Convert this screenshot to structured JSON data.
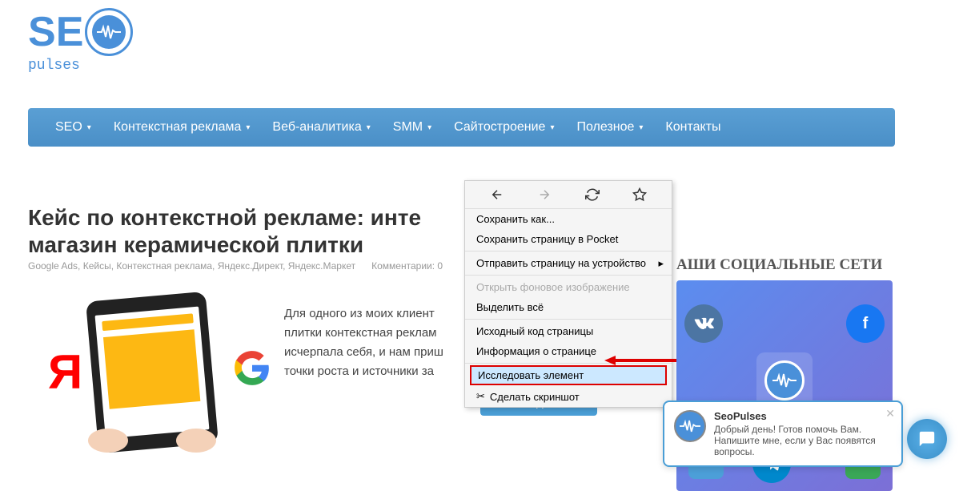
{
  "logo": {
    "brand": "SEO",
    "sub": "pulses"
  },
  "nav": [
    {
      "label": "SEO",
      "dropdown": true
    },
    {
      "label": "Контекстная реклама",
      "dropdown": true
    },
    {
      "label": "Веб-аналитика",
      "dropdown": true
    },
    {
      "label": "SMM",
      "dropdown": true
    },
    {
      "label": "Сайтостроение",
      "dropdown": true
    },
    {
      "label": "Полезное",
      "dropdown": true
    },
    {
      "label": "Контакты",
      "dropdown": false
    }
  ],
  "article": {
    "title": "Кейс по контекстной рекламе: интернет-магазин керамической плитки",
    "title_visible_part1": "Кейс по контекстной рекламе: инте",
    "title_visible_part2": "магазин керамической плитки",
    "categories": "Google Ads, Кейсы, Контекстная реклама, Яндекс.Директ, Яндекс.Маркет",
    "comments_label": "Комментарии: 0",
    "body": "Для одного из моих клиент плитки контекстная реклам исчерпала себя, и нам приш точки роста и источники за",
    "read_more": "Читать далее"
  },
  "sidebar": {
    "title": "АШИ СОЦИАЛЬНЫЕ СЕТИ"
  },
  "context_menu": {
    "items": [
      {
        "label": "Сохранить как...",
        "type": "item"
      },
      {
        "label": "Сохранить страницу в Pocket",
        "type": "item"
      },
      {
        "type": "divider"
      },
      {
        "label": "Отправить страницу на устройство",
        "type": "submenu"
      },
      {
        "type": "divider"
      },
      {
        "label": "Открыть фоновое изображение",
        "type": "disabled"
      },
      {
        "label": "Выделить всё",
        "type": "item"
      },
      {
        "type": "divider"
      },
      {
        "label": "Исходный код страницы",
        "type": "item"
      },
      {
        "label": "Информация о странице",
        "type": "item"
      },
      {
        "type": "divider"
      },
      {
        "label": "Исследовать элемент",
        "type": "highlighted"
      },
      {
        "label": "Сделать скриншот",
        "type": "last"
      }
    ]
  },
  "chat": {
    "title": "SeoPulses",
    "message": "Добрый день! Готов помочь Вам. Напишите мне, если у Вас появятся вопросы."
  }
}
